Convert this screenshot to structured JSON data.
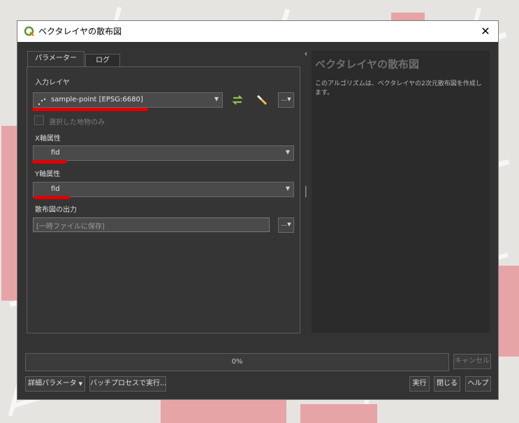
{
  "window": {
    "title": "ベクタレイヤの散布図",
    "close_symbol": "✕"
  },
  "tabs": [
    {
      "label": "パラメーター"
    },
    {
      "label": "ログ"
    }
  ],
  "params": {
    "input_layer_label": "入力レイヤ",
    "input_layer_value": "sample-point [EPSG:6680]",
    "selected_only_label": "選択した地物のみ",
    "x_label": "X軸属性",
    "x_value": "fid",
    "y_label": "Y軸属性",
    "y_value": "fid",
    "output_label": "散布図の出力",
    "output_placeholder": "[一時ファイルに保存]",
    "dots_label": "…"
  },
  "help": {
    "title": "ベクタレイヤの散布図",
    "text": "このアルゴリズムは、ベクタレイヤの2次元散布図を作成します。"
  },
  "progress": {
    "text": "0%",
    "value": 0
  },
  "buttons": {
    "cancel": "キャンセル",
    "advanced": "詳細パラメータ",
    "batch": "バッチプロセスで実行...",
    "run": "実行",
    "close": "閉じる",
    "help": "ヘルプ"
  },
  "colors": {
    "annotation_red": "#e00000",
    "accent_green": "#589632"
  }
}
